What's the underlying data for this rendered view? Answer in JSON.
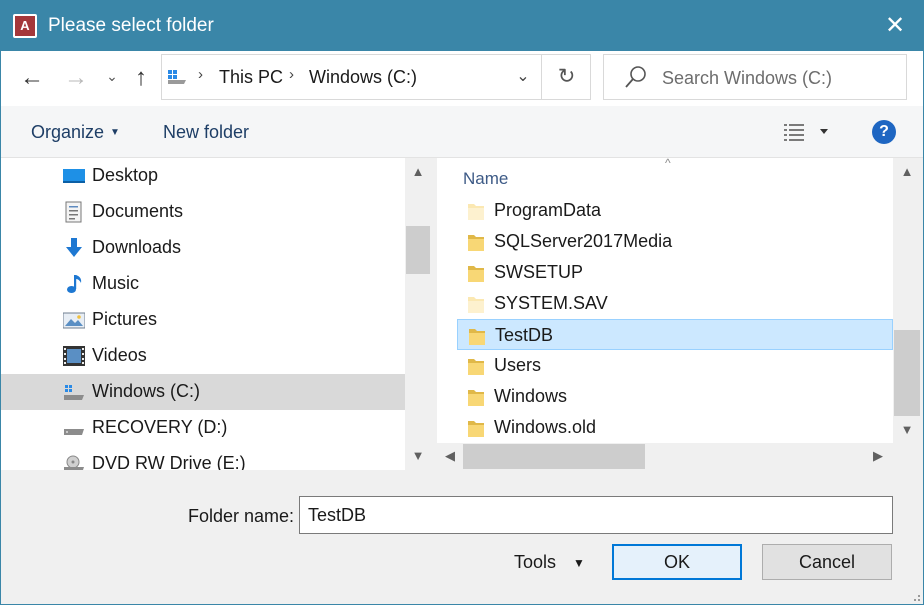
{
  "window": {
    "title": "Please select folder",
    "app_icon_letter": "A",
    "close_glyph": "✕"
  },
  "nav": {
    "back_glyph": "←",
    "forward_glyph": "→",
    "recent_glyph": "⌄",
    "up_glyph": "↑",
    "address": {
      "segments": [
        "This PC",
        "Windows (C:)"
      ],
      "separator": "›",
      "dropdown_glyph": "⌄",
      "refresh_glyph": "↻"
    },
    "search_placeholder": "Search Windows (C:)"
  },
  "commands": {
    "organize": "Organize",
    "new_folder": "New folder",
    "help": "?"
  },
  "sidebar": {
    "items": [
      {
        "label": "Desktop",
        "icon": "desktop-icon"
      },
      {
        "label": "Documents",
        "icon": "documents-icon"
      },
      {
        "label": "Downloads",
        "icon": "downloads-icon"
      },
      {
        "label": "Music",
        "icon": "music-icon"
      },
      {
        "label": "Pictures",
        "icon": "pictures-icon"
      },
      {
        "label": "Videos",
        "icon": "videos-icon"
      },
      {
        "label": "Windows (C:)",
        "icon": "windows-drive-icon",
        "selected": true
      },
      {
        "label": "RECOVERY (D:)",
        "icon": "drive-icon"
      },
      {
        "label": "DVD RW Drive (E:)",
        "icon": "dvd-drive-icon"
      }
    ]
  },
  "filelist": {
    "column_header": "Name",
    "sort_glyph": "^",
    "rows": [
      {
        "name": "ProgramData",
        "hidden": true
      },
      {
        "name": "SQLServer2017Media",
        "hidden": false
      },
      {
        "name": "SWSETUP",
        "hidden": false
      },
      {
        "name": "SYSTEM.SAV",
        "hidden": true
      },
      {
        "name": "TestDB",
        "hidden": false,
        "selected": true
      },
      {
        "name": "Users",
        "hidden": false
      },
      {
        "name": "Windows",
        "hidden": false
      },
      {
        "name": "Windows.old",
        "hidden": false
      }
    ]
  },
  "bottom": {
    "folder_name_label": "Folder name:",
    "folder_name_value": "TestDB",
    "tools_label": "Tools",
    "tools_caret": "▼",
    "ok_label": "OK",
    "cancel_label": "Cancel"
  },
  "colors": {
    "titlebar": "#3a86a8",
    "selection": "#cce8ff",
    "folder": "#f8d775",
    "help": "#1e66c2"
  }
}
